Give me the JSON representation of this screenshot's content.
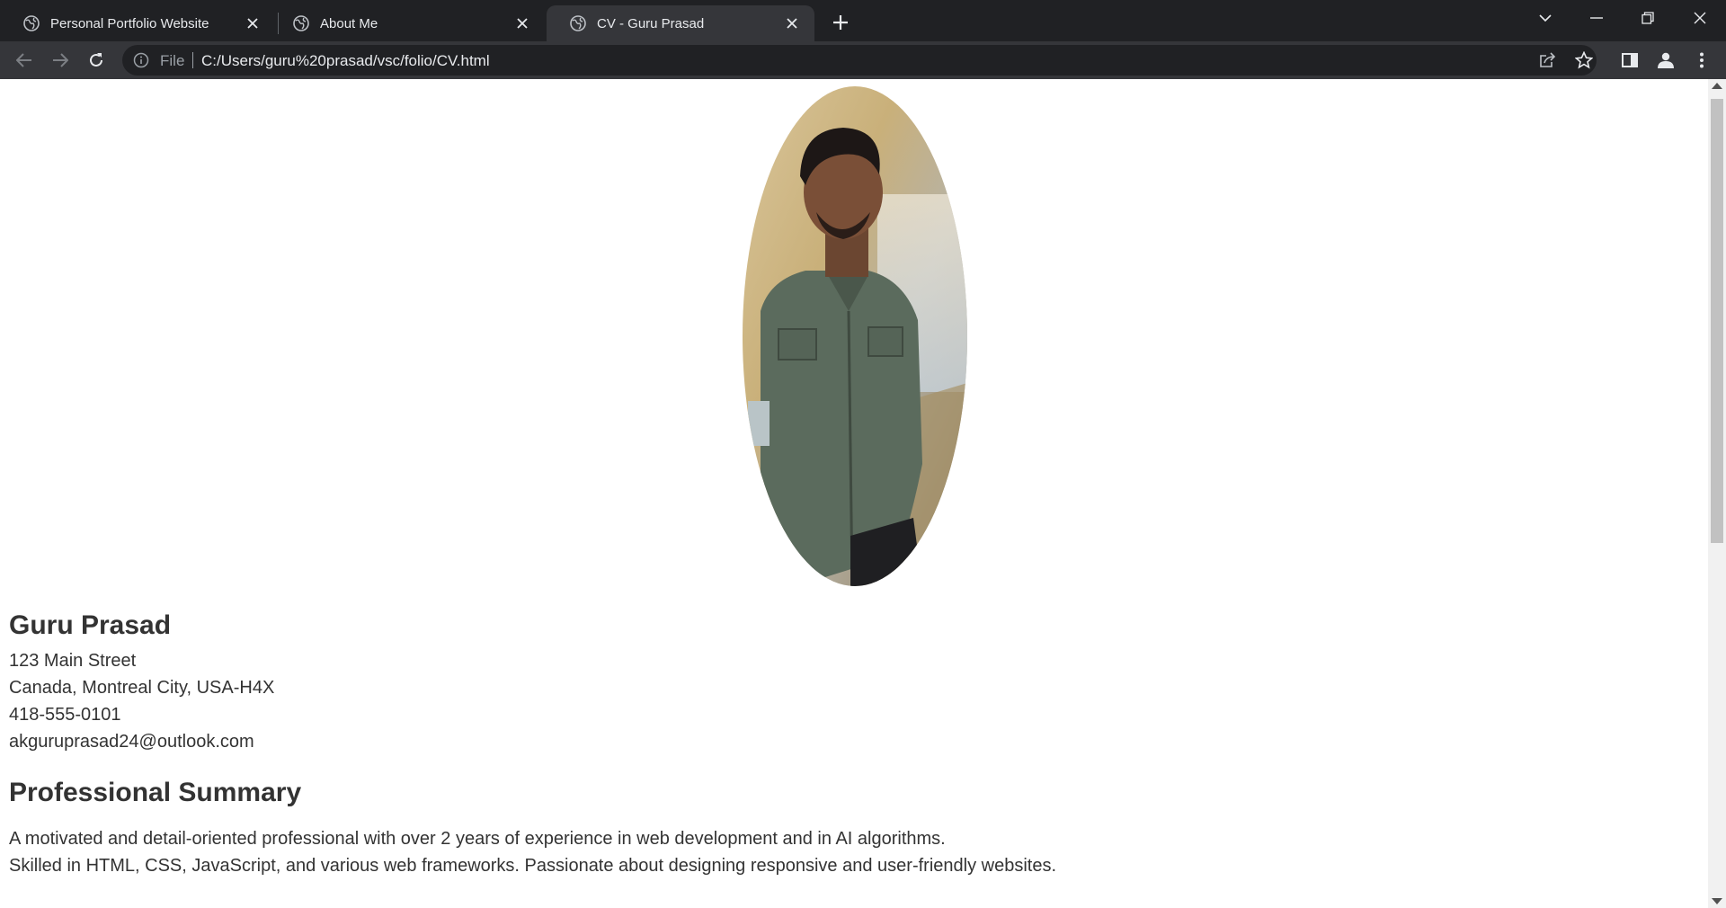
{
  "browser": {
    "tabs": [
      {
        "title": "Personal Portfolio Website",
        "active": false
      },
      {
        "title": "About Me",
        "active": false
      },
      {
        "title": "CV - Guru Prasad",
        "active": true
      }
    ],
    "address": {
      "scheme_label": "File",
      "url": "C:/Users/guru%20prasad/vsc/folio/CV.html"
    },
    "colors": {
      "tabstrip": "#202124",
      "toolbar": "#35363a",
      "omnibox": "#202124",
      "text": "#e8eaed"
    }
  },
  "page": {
    "photo_alt": "profile-photo",
    "name": "Guru Prasad",
    "contact": {
      "street": "123 Main Street",
      "city": "Canada, Montreal City, USA-H4X",
      "phone": "418-555-0101",
      "email": "akguruprasad24@outlook.com"
    },
    "summary": {
      "heading": "Professional Summary",
      "lines": [
        "A motivated and detail-oriented professional with over 2 years of experience in web development and in AI algorithms.",
        "Skilled in HTML, CSS, JavaScript, and various web frameworks. Passionate about designing responsive and user-friendly websites."
      ]
    },
    "text_color": "#333333"
  }
}
